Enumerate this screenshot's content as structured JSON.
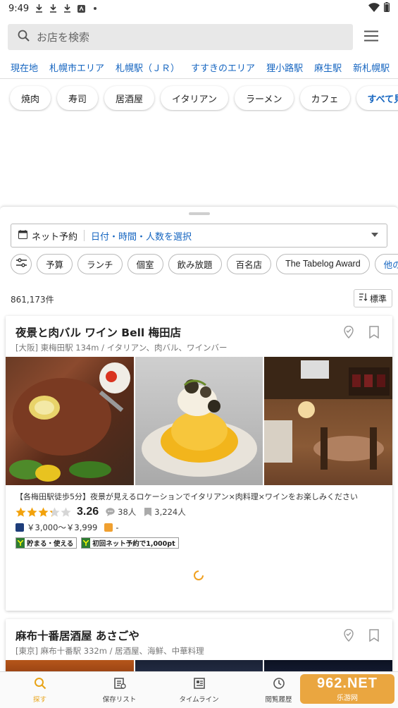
{
  "status_bar": {
    "time": "9:49",
    "left_icons": [
      "download-icon",
      "download-icon",
      "download-icon",
      "app-icon",
      "dot-icon"
    ],
    "right_icons": [
      "wifi-icon",
      "battery-icon"
    ]
  },
  "search": {
    "placeholder": "お店を検索"
  },
  "areas": [
    "現在地",
    "札幌市エリア",
    "札幌駅（ＪＲ）",
    "すすきのエリア",
    "狸小路駅",
    "麻生駅",
    "新札幌駅"
  ],
  "genres": [
    "焼肉",
    "寿司",
    "居酒屋",
    "イタリアン",
    "ラーメン",
    "カフェ"
  ],
  "genres_more": "すべて見る",
  "reservation": {
    "label": "ネット予約",
    "select_text": "日付・時間・人数を選択"
  },
  "filters": [
    "予算",
    "ランチ",
    "個室",
    "飲み放題",
    "百名店",
    "The Tabelog Award",
    "他の検索"
  ],
  "result_count": "861,173件",
  "sort_label": "標準",
  "restaurants": [
    {
      "name": "夜景と肉バル ワイン Bell 梅田店",
      "meta": "[大阪] 東梅田駅 134m / イタリアン、肉バル、ワインバー",
      "catch": "【各梅田駅徒歩5分】夜景が見えるロケーションでイタリアン×肉料理×ワインをお楽しみください",
      "rating": "3.26",
      "rating_value": 3.26,
      "reviews": "38人",
      "saves": "3,224人",
      "price_dinner": "￥3,000～￥3,999",
      "price_lunch": "-",
      "tags": [
        "貯まる・使える",
        "初回ネット予約で1,000pt"
      ]
    },
    {
      "name": "麻布十番居酒屋 あさごや",
      "meta": "[東京] 麻布十番駅 332m / 居酒屋、海鮮、中華料理"
    }
  ],
  "bottom_nav": [
    {
      "label": "探す",
      "icon": "search-icon"
    },
    {
      "label": "保存リスト",
      "icon": "saved-list-icon"
    },
    {
      "label": "タイムライン",
      "icon": "timeline-icon"
    },
    {
      "label": "閲覧履歴",
      "icon": "history-icon"
    }
  ],
  "watermark": {
    "line1": "962.NET",
    "line2": "乐游网"
  },
  "colors": {
    "link": "#1565c0",
    "active_nav": "#e8a317",
    "star": "#f2a20c"
  }
}
